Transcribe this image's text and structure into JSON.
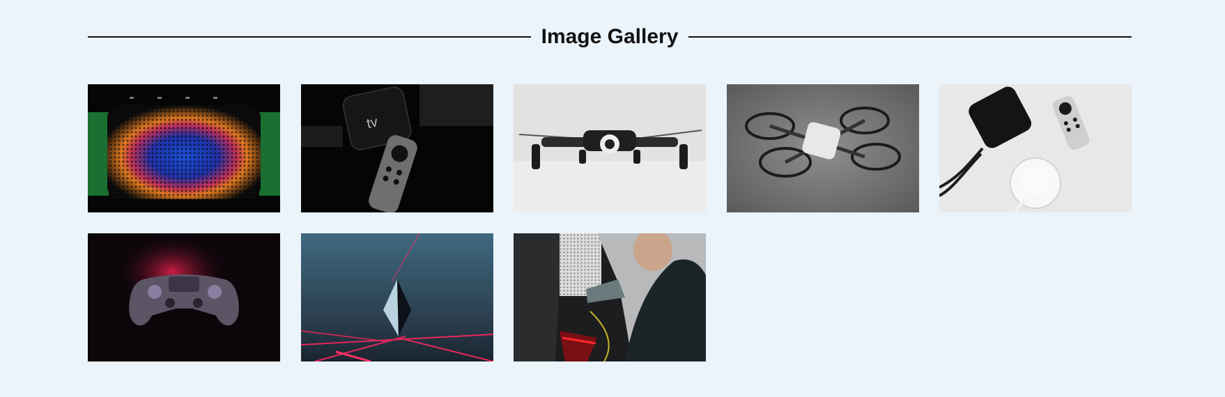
{
  "gallery": {
    "title": "Image Gallery",
    "images": [
      {
        "subject": "speaker-light"
      },
      {
        "subject": "apple-tv-remote"
      },
      {
        "subject": "drone-white"
      },
      {
        "subject": "drone-grey"
      },
      {
        "subject": "apple-tv-homepod"
      },
      {
        "subject": "game-controller"
      },
      {
        "subject": "crystal-shape"
      },
      {
        "subject": "ev-charging"
      }
    ]
  },
  "colors": {
    "background": "#ebf3fb",
    "heading": "#111111"
  }
}
